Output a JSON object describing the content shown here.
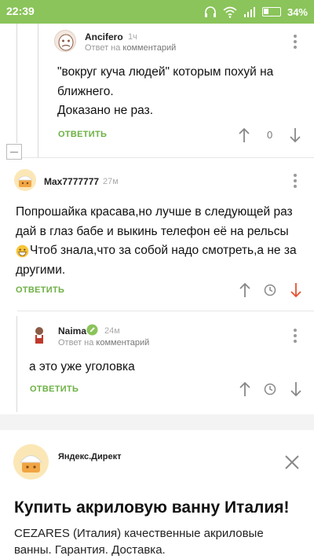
{
  "status_bar": {
    "time": "22:39",
    "battery": "34%"
  },
  "comments": [
    {
      "author": "Ancifero",
      "time": "1ч",
      "reply_prefix": "Ответ на",
      "reply_link": "комментарий",
      "text_lines": [
        "\"вокруг куча людей\" которым похуй на",
        "ближнего.",
        "Доказано не раз."
      ],
      "reply_label": "ОТВЕТИТЬ",
      "rating": "0"
    },
    {
      "author": "Max7777777",
      "time": "27м",
      "text_lines": [
        "Попрошайка красава,но лучше в следующей раз",
        "дай в глаз бабе и выкинь телефон её на рельсы",
        "Чтоб знала,что за собой надо смотреть,а не за",
        "другими."
      ],
      "reply_label": "ОТВЕТИТЬ"
    },
    {
      "author": "Naima",
      "time": "24м",
      "reply_prefix": "Ответ на",
      "reply_link": "комментарий",
      "text_lines": [
        "а это уже уголовка"
      ],
      "reply_label": "ОТВЕТИТЬ"
    }
  ],
  "ad": {
    "source": "Яндекс.Директ",
    "title": "Купить акриловую ванну Италия!",
    "desc_lines": [
      "CEZARES (Италия) качественные акриловые",
      "ванны. Гарантия. Доставка."
    ]
  },
  "icons": {
    "upvote": "arrow-up-icon",
    "downvote": "arrow-down-icon",
    "history": "clock-icon",
    "more": "kebab-menu-icon",
    "edit": "pencil-badge-icon",
    "close": "close-icon",
    "collapse": "collapse-icon"
  },
  "colors": {
    "status_bar": "#8ac45a",
    "reply_green": "#6cb043",
    "downvote_active": "#e8502f"
  }
}
